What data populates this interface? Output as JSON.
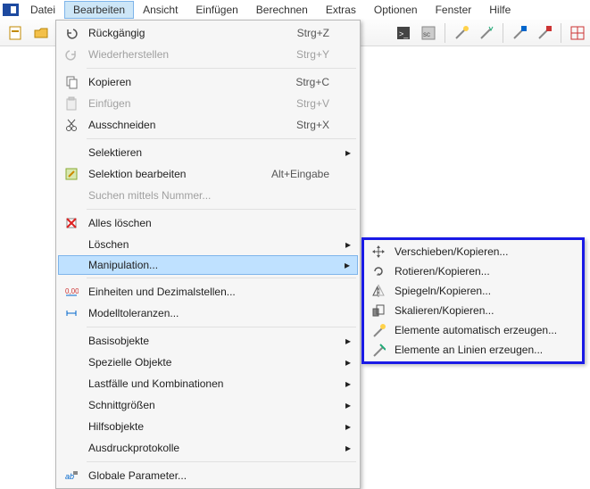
{
  "menubar": {
    "items": [
      "Datei",
      "Bearbeiten",
      "Ansicht",
      "Einfügen",
      "Berechnen",
      "Extras",
      "Optionen",
      "Fenster",
      "Hilfe"
    ],
    "active_index": 1
  },
  "dropdown": {
    "groups": [
      [
        {
          "icon": "undo-icon",
          "label": "Rückgängig",
          "shortcut": "Strg+Z",
          "disabled": false,
          "arrow": false
        },
        {
          "icon": "redo-icon",
          "label": "Wiederherstellen",
          "shortcut": "Strg+Y",
          "disabled": true,
          "arrow": false
        }
      ],
      [
        {
          "icon": "copy-icon",
          "label": "Kopieren",
          "shortcut": "Strg+C",
          "disabled": false,
          "arrow": false
        },
        {
          "icon": "paste-icon",
          "label": "Einfügen",
          "shortcut": "Strg+V",
          "disabled": true,
          "arrow": false
        },
        {
          "icon": "cut-icon",
          "label": "Ausschneiden",
          "shortcut": "Strg+X",
          "disabled": false,
          "arrow": false
        }
      ],
      [
        {
          "icon": "",
          "label": "Selektieren",
          "shortcut": "",
          "disabled": false,
          "arrow": true
        },
        {
          "icon": "edit-selection-icon",
          "label": "Selektion bearbeiten",
          "shortcut": "Alt+Eingabe",
          "disabled": false,
          "arrow": false
        },
        {
          "icon": "",
          "label": "Suchen mittels Nummer...",
          "shortcut": "",
          "disabled": true,
          "arrow": false
        }
      ],
      [
        {
          "icon": "delete-all-icon",
          "label": "Alles löschen",
          "shortcut": "",
          "disabled": false,
          "arrow": false
        },
        {
          "icon": "",
          "label": "Löschen",
          "shortcut": "",
          "disabled": false,
          "arrow": true
        },
        {
          "icon": "",
          "label": "Manipulation...",
          "shortcut": "",
          "disabled": false,
          "arrow": true,
          "highlight": true
        }
      ],
      [
        {
          "icon": "units-icon",
          "label": "Einheiten und Dezimalstellen...",
          "shortcut": "",
          "disabled": false,
          "arrow": false
        },
        {
          "icon": "tolerance-icon",
          "label": "Modelltoleranzen...",
          "shortcut": "",
          "disabled": false,
          "arrow": false
        }
      ],
      [
        {
          "icon": "",
          "label": "Basisobjekte",
          "shortcut": "",
          "disabled": false,
          "arrow": true
        },
        {
          "icon": "",
          "label": "Spezielle Objekte",
          "shortcut": "",
          "disabled": false,
          "arrow": true
        },
        {
          "icon": "",
          "label": "Lastfälle und Kombinationen",
          "shortcut": "",
          "disabled": false,
          "arrow": true
        },
        {
          "icon": "",
          "label": "Schnittgrößen",
          "shortcut": "",
          "disabled": false,
          "arrow": true
        },
        {
          "icon": "",
          "label": "Hilfsobjekte",
          "shortcut": "",
          "disabled": false,
          "arrow": true
        },
        {
          "icon": "",
          "label": "Ausdruckprotokolle",
          "shortcut": "",
          "disabled": false,
          "arrow": true
        }
      ],
      [
        {
          "icon": "params-icon",
          "label": "Globale Parameter...",
          "shortcut": "",
          "disabled": false,
          "arrow": false
        }
      ]
    ]
  },
  "submenu": {
    "items": [
      {
        "icon": "move-icon",
        "label": "Verschieben/Kopieren..."
      },
      {
        "icon": "rotate-icon",
        "label": "Rotieren/Kopieren..."
      },
      {
        "icon": "mirror-icon",
        "label": "Spiegeln/Kopieren..."
      },
      {
        "icon": "scale-icon",
        "label": "Skalieren/Kopieren..."
      },
      {
        "icon": "auto-gen-icon",
        "label": "Elemente automatisch erzeugen..."
      },
      {
        "icon": "line-gen-icon",
        "label": "Elemente an Linien erzeugen..."
      }
    ]
  }
}
